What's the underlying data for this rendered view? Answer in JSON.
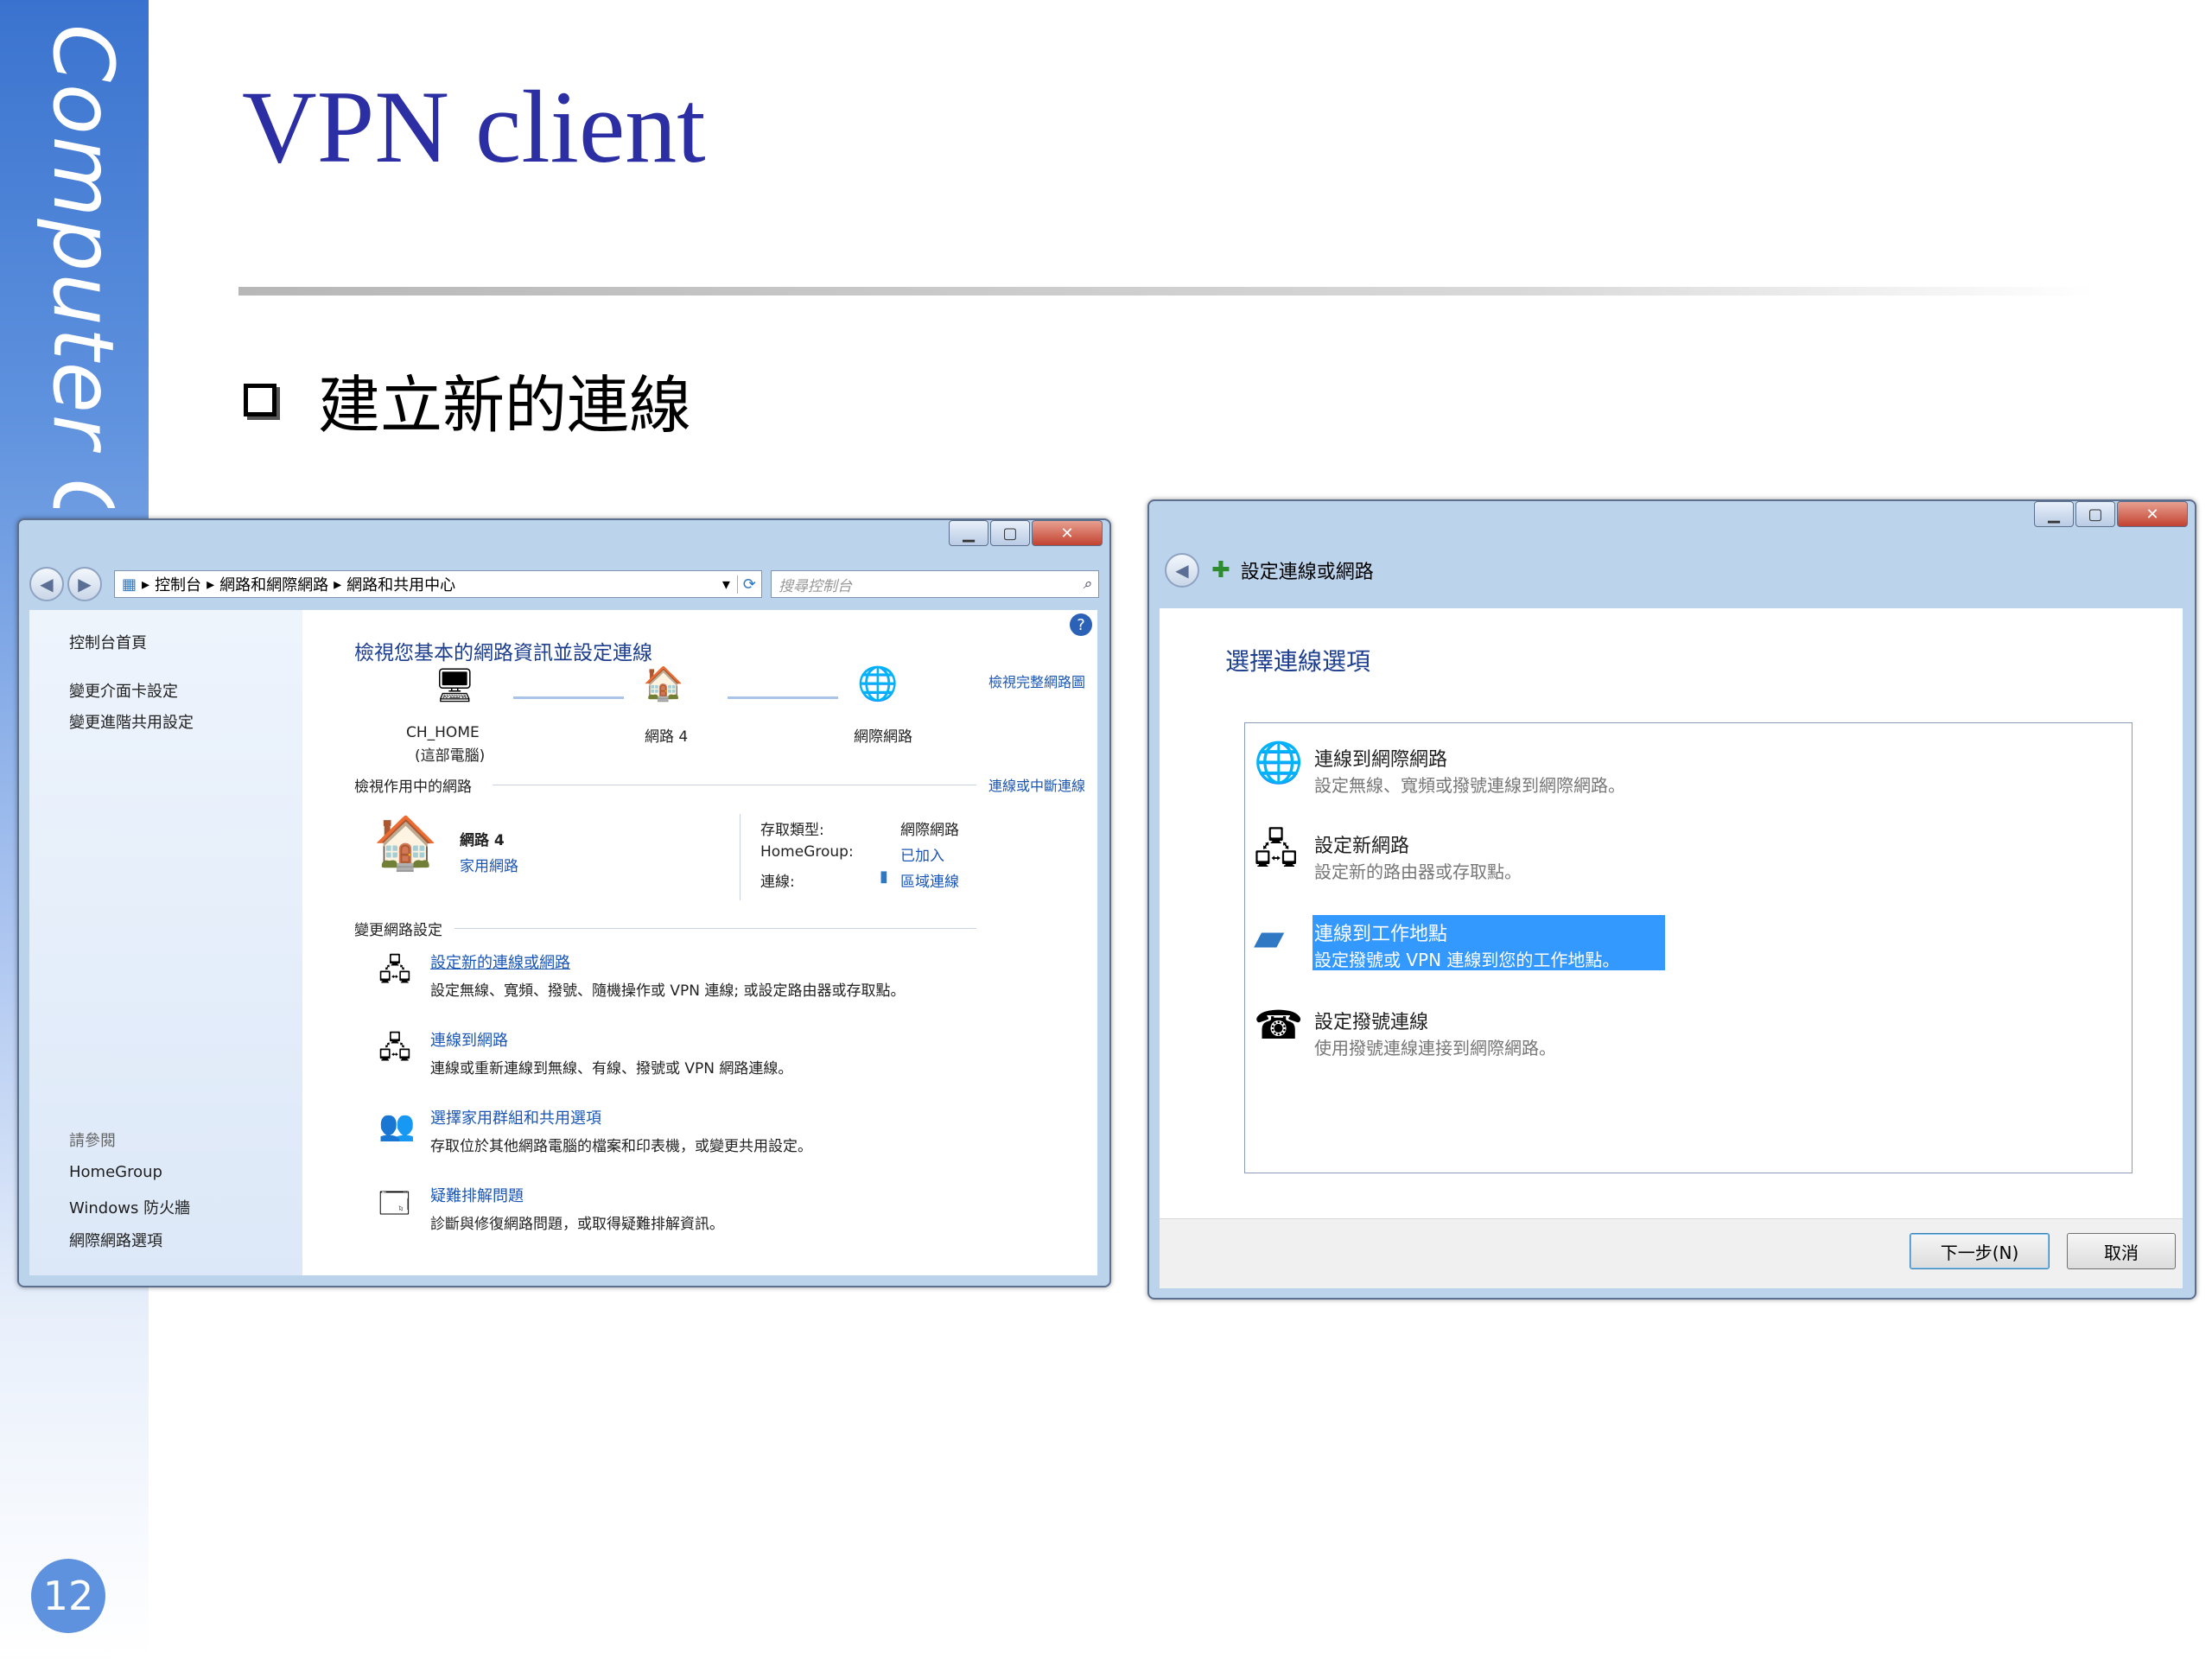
{
  "sidebar": {
    "text": "Computer Cen",
    "page_number": "12"
  },
  "slide": {
    "title": "VPN client",
    "bullet": "建立新的連線"
  },
  "left_window": {
    "breadcrumb": [
      "控制台",
      "網路和網際網路",
      "網路和共用中心"
    ],
    "search_placeholder": "搜尋控制台",
    "nav_links": [
      "控制台首頁",
      "變更介面卡設定",
      "變更進階共用設定"
    ],
    "see_also_heading": "請參閱",
    "see_also": [
      "HomeGroup",
      "Windows 防火牆",
      "網際網路選項"
    ],
    "main_heading": "檢視您基本的網路資訊並設定連線",
    "view_full_map": "檢視完整網路圖",
    "map_nodes": [
      "CH_HOME",
      "(這部電腦)",
      "網路 4",
      "網際網路"
    ],
    "active_networks_label": "檢視作用中的網路",
    "connect_disconnect": "連線或中斷連線",
    "network_name": "網路 4",
    "network_type": "家用網路",
    "access_type_label": "存取類型:",
    "access_type_value": "網際網路",
    "homegroup_label": "HomeGroup:",
    "homegroup_value": "已加入",
    "connections_label": "連線:",
    "connections_value": "區域連線",
    "change_settings_heading": "變更網路設定",
    "tasks": [
      {
        "title": "設定新的連線或網路",
        "desc": "設定無線、寬頻、撥號、隨機操作或 VPN 連線; 或設定路由器或存取點。"
      },
      {
        "title": "連線到網路",
        "desc": "連線或重新連線到無線、有線、撥號或 VPN 網路連線。"
      },
      {
        "title": "選擇家用群組和共用選項",
        "desc": "存取位於其他網路電腦的檔案和印表機，或變更共用設定。"
      },
      {
        "title": "疑難排解問題",
        "desc": "診斷與修復網路問題，或取得疑難排解資訊。"
      }
    ]
  },
  "right_window": {
    "title": "設定連線或網路",
    "heading": "選擇連線選項",
    "options": [
      {
        "title": "連線到網際網路",
        "desc": "設定無線、寬頻或撥號連線到網際網路。"
      },
      {
        "title": "設定新網路",
        "desc": "設定新的路由器或存取點。"
      },
      {
        "title": "連線到工作地點",
        "desc": "設定撥號或 VPN 連線到您的工作地點。"
      },
      {
        "title": "設定撥號連線",
        "desc": "使用撥號連線連接到網際網路。"
      }
    ],
    "next_button": "下一步(N)",
    "cancel_button": "取消"
  }
}
